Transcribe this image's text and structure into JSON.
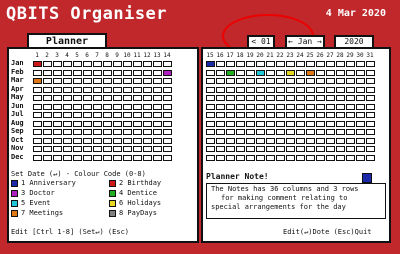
{
  "app": {
    "title": "QBITS Organiser",
    "date": "4 Mar 2020"
  },
  "nav": {
    "day": "< 01 >",
    "month": "← Jan →",
    "year": "2020"
  },
  "planner": {
    "tab_label": "Planner",
    "months": [
      "Jan",
      "Feb",
      "Mar",
      "Apr",
      "May",
      "Jun",
      "Jul",
      "Aug",
      "Sep",
      "Oct",
      "Nov",
      "Dec"
    ],
    "days_left": [
      "1",
      "2",
      "3",
      "4",
      "5",
      "6",
      "7",
      "8",
      "9",
      "10",
      "11",
      "12",
      "13",
      "14"
    ],
    "days_right": [
      "15",
      "16",
      "17",
      "18",
      "19",
      "20",
      "21",
      "22",
      "23",
      "24",
      "25",
      "26",
      "27",
      "28",
      "29",
      "30",
      "31"
    ]
  },
  "legend": {
    "title": "Set Date (↵) - Colour Code (0-8)",
    "items": [
      {
        "label": "1 Anniversary",
        "color": "#1a2aa8"
      },
      {
        "label": "2 Birthday",
        "color": "#d01818"
      },
      {
        "label": "3 Doctor",
        "color": "#b020c0"
      },
      {
        "label": "4 Dentice",
        "color": "#20b020"
      },
      {
        "label": "5 Event",
        "color": "#20c8d8"
      },
      {
        "label": "6 Holidays",
        "color": "#e8d820"
      },
      {
        "label": "7 Meetings",
        "color": "#e07818"
      },
      {
        "label": "8 PayDays",
        "color": "#808080"
      }
    ]
  },
  "hints": {
    "left": "Edit [Ctrl 1-8] (Set↵) (Esc)",
    "right": "Edit(↵)Dote (Esc)Quit"
  },
  "note": {
    "title": "Planner Note!",
    "lines": [
      "The Notes has 36 columns and 3 rows",
      "for making comment relating to",
      "special arrangements for the day"
    ]
  }
}
